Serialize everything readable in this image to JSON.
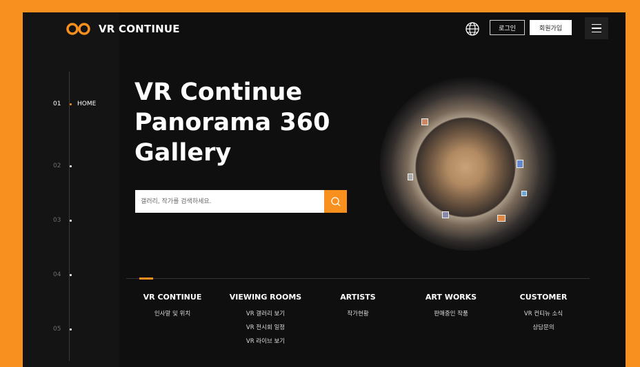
{
  "header": {
    "brand": "VR CONTINUE",
    "login_label": "로그인",
    "join_label": "회원가입"
  },
  "sidenav": [
    {
      "num": "01",
      "label": "HOME",
      "active": true
    },
    {
      "num": "02",
      "label": "",
      "active": false
    },
    {
      "num": "03",
      "label": "",
      "active": false
    },
    {
      "num": "04",
      "label": "",
      "active": false
    },
    {
      "num": "05",
      "label": "",
      "active": false
    }
  ],
  "hero": {
    "line1": "VR Continue",
    "line2": "Panorama 360",
    "line3": "Gallery",
    "search_placeholder": "갤러리, 작가를 검색하세요."
  },
  "footer_menu": [
    {
      "title": "VR CONTINUE",
      "items": [
        "인사말 및 위치"
      ]
    },
    {
      "title": "VIEWING ROOMS",
      "items": [
        "VR 갤러리 보기",
        "VR 전시회 일정",
        "VR 라이브 보기"
      ]
    },
    {
      "title": "ARTISTS",
      "items": [
        "작가현황"
      ]
    },
    {
      "title": "ART WORKS",
      "items": [
        "판매중인 작품"
      ]
    },
    {
      "title": "CUSTOMER",
      "items": [
        "VR 컨티뉴 소식",
        "상담문의"
      ]
    }
  ],
  "colors": {
    "accent": "#f7901e",
    "background": "#0f0f0f"
  },
  "icons": {
    "logo": "infinity-logo-icon",
    "language": "globe-icon",
    "search": "search-icon",
    "menu": "hamburger-menu-icon"
  }
}
